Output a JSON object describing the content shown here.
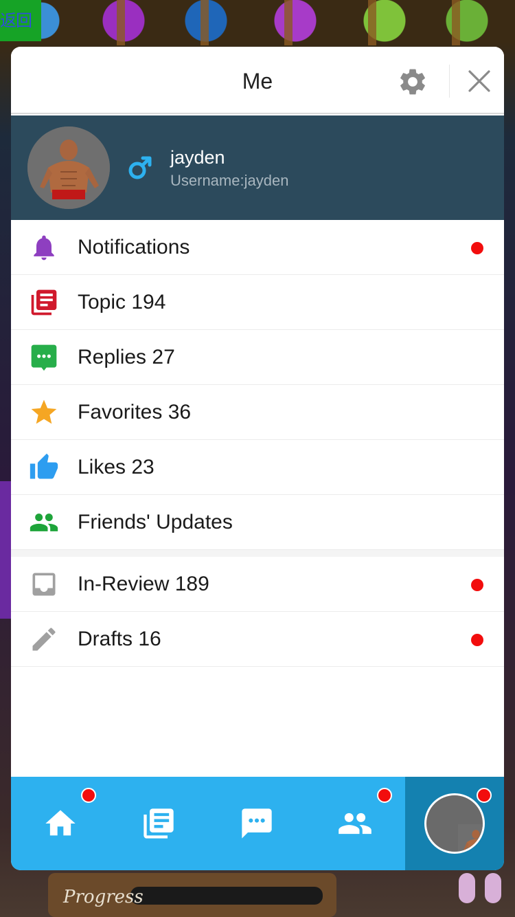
{
  "back_label": "返回",
  "header": {
    "title": "Me"
  },
  "profile": {
    "name": "jayden",
    "username_text": "Username:jayden",
    "gender_icon": "male-icon",
    "gender_color": "#2db1ef"
  },
  "menu": [
    {
      "label": "Notifications",
      "icon": "bell-icon",
      "color": "#8e3fc0",
      "dot": true
    },
    {
      "label": "Topic 194",
      "icon": "topics-icon",
      "color": "#d0192c",
      "dot": false
    },
    {
      "label": "Replies 27",
      "icon": "chat-icon",
      "color": "#27ae4a",
      "dot": false
    },
    {
      "label": "Favorites 36",
      "icon": "star-icon",
      "color": "#f5a623",
      "dot": false
    },
    {
      "label": "Likes 23",
      "icon": "thumbs-up-icon",
      "color": "#2d9df0",
      "dot": false
    },
    {
      "label": "Friends' Updates",
      "icon": "people-icon",
      "color": "#1ea43a",
      "dot": false
    }
  ],
  "menu2": [
    {
      "label": "In-Review 189",
      "icon": "inbox-icon",
      "color": "#9a9a9a",
      "dot": true
    },
    {
      "label": "Drafts 16",
      "icon": "pencil-icon",
      "color": "#9a9a9a",
      "dot": true
    }
  ],
  "tabbar": {
    "tabs": [
      {
        "name": "home",
        "icon": "home-icon",
        "dot": true
      },
      {
        "name": "topics",
        "icon": "topics-icon",
        "dot": false
      },
      {
        "name": "messages",
        "icon": "chat-icon",
        "dot": false
      },
      {
        "name": "friends",
        "icon": "people-icon",
        "dot": true
      },
      {
        "name": "me",
        "icon": "avatar",
        "dot": true
      }
    ],
    "accent": "#2db1ef",
    "active": "#1481b0"
  },
  "background": {
    "progress_label": "Progress"
  }
}
